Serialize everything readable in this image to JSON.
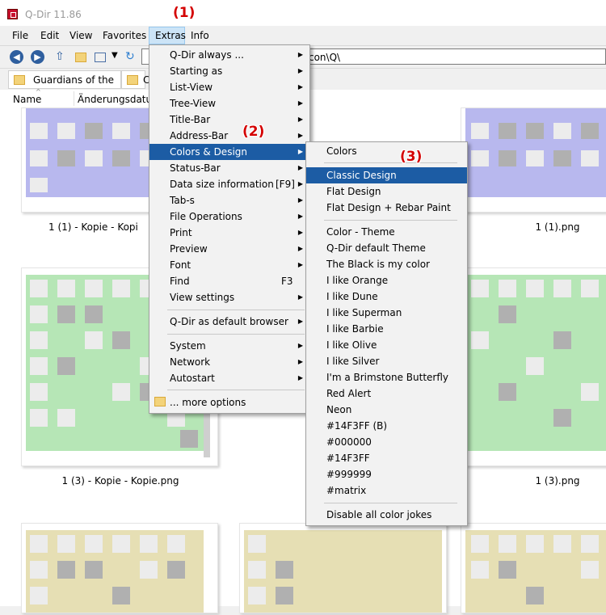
{
  "window": {
    "title": "Q-Dir 11.86"
  },
  "menubar": {
    "items": [
      "File",
      "Edit",
      "View",
      "Favorites",
      "Extras",
      "Info"
    ]
  },
  "address": {
    "value": "g\\icon\\Q\\"
  },
  "tabs": {
    "first": "Guardians of the ...",
    "second": "C"
  },
  "columns": {
    "name": "Name",
    "date": "Änderungsdatum"
  },
  "files": {
    "row1_left": "1 (1) - Kopie - Kopi",
    "row1_right": "1 (1).png",
    "row2_left": "1 (3) - Kopie - Kopie.png",
    "row2_right": "1 (3).png"
  },
  "extras_menu": {
    "items": [
      "Q-Dir always ...",
      "Starting as",
      "List-View",
      "Tree-View",
      "Title-Bar",
      "Address-Bar",
      "Colors & Design",
      "Status-Bar",
      "Data size information",
      "Tab-s",
      "File Operations",
      "Print",
      "Preview",
      "Font",
      "Find",
      "View settings",
      "Q-Dir as default browser",
      "System",
      "Network",
      "Autostart",
      "... more options"
    ],
    "shortcut_data_size": "[F9]",
    "shortcut_find": "F3"
  },
  "colors_menu": {
    "items": [
      "Colors",
      "Classic Design",
      "Flat Design",
      "Flat Design + Rebar Paint",
      "Color - Theme",
      "Q-Dir default Theme",
      "The Black is my color",
      "I like Orange",
      "I like Dune",
      "I like Superman",
      "I like Barbie",
      "I like Olive",
      "I like Silver",
      "I'm a Brimstone Butterfly",
      "Red Alert",
      "Neon",
      "#14F3FF (B)",
      "#000000",
      "#14F3FF",
      "#999999",
      "#matrix",
      "Disable all color jokes"
    ]
  },
  "annotations": {
    "a1": "(1)",
    "a2": "(2)",
    "a3": "(3)"
  },
  "colors": {
    "highlight": "#1c5ca4",
    "annotation": "#d40000",
    "purple": "#b8b8ee",
    "green": "#b6e6b6",
    "olive": "#e6dfb4"
  }
}
